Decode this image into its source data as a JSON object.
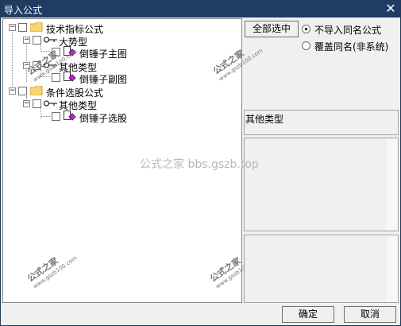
{
  "window": {
    "title": "导入公式",
    "close_glyph": "✕"
  },
  "tree": {
    "nodes": [
      {
        "label": "技术指标公式"
      },
      {
        "label": "大势型"
      },
      {
        "label": "倒锤子主图"
      },
      {
        "label": "其他类型"
      },
      {
        "label": "倒锤子副图"
      },
      {
        "label": "条件选股公式"
      },
      {
        "label": "其他类型"
      },
      {
        "label": "倒锤子选股"
      }
    ]
  },
  "right": {
    "select_all_label": "全部选中",
    "radio_options": [
      {
        "label": "不导入同名公式",
        "selected": true
      },
      {
        "label": "覆盖同名(非系统)",
        "selected": false
      }
    ],
    "type_value": "其他类型"
  },
  "footer": {
    "ok_label": "确定",
    "cancel_label": "取消"
  },
  "watermark": {
    "center_text": "公式之家 bbs.gszb.top",
    "stamp_text": "公式之家",
    "stamp_sub": "www.gszb100.com"
  },
  "colors": {
    "titlebar": "#1e3c64",
    "folder": "#f5d76e",
    "doc_icon": "#c026d3"
  }
}
